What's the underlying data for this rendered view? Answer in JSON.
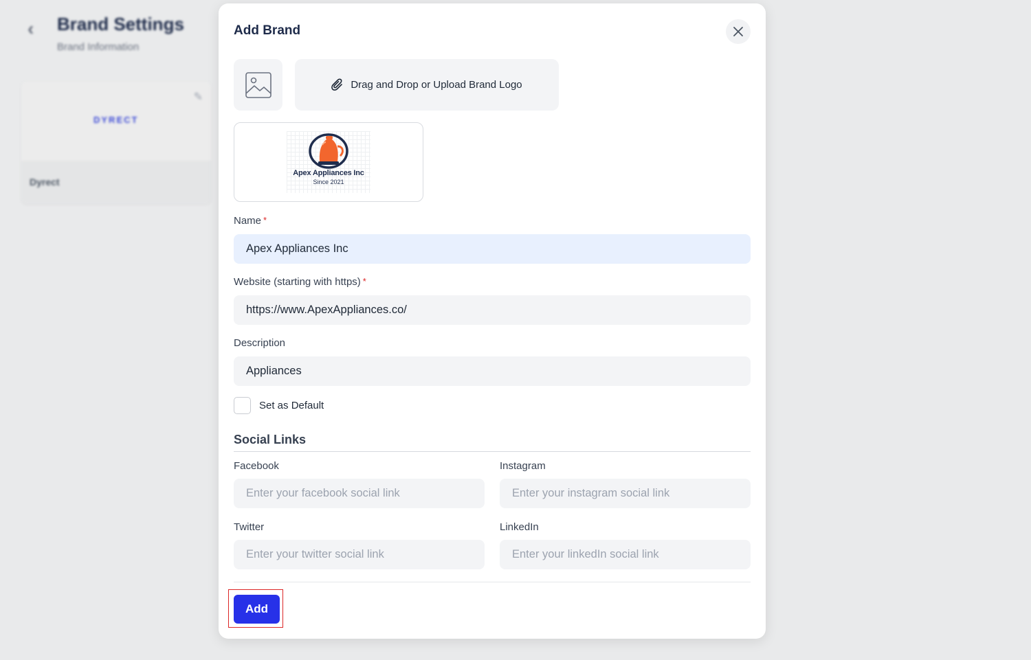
{
  "background": {
    "back_icon": "chevron-left-icon",
    "title": "Brand Settings",
    "subtitle": "Brand Information",
    "card": {
      "logo_text": "DYRECT",
      "name": "Dyrect",
      "edit_icon": "pencil-icon"
    }
  },
  "modal": {
    "title": "Add Brand",
    "close_icon": "close-icon",
    "image_placeholder_icon": "image-icon",
    "upload": {
      "icon": "paperclip-icon",
      "label": "Drag and Drop or Upload Brand Logo"
    },
    "logo_preview": {
      "brand_text": "Apex Appliances Inc",
      "since_text": "Since 2021"
    },
    "fields": {
      "name": {
        "label": "Name",
        "required_mark": "*",
        "value": "Apex Appliances Inc"
      },
      "website": {
        "label": "Website (starting with https)",
        "required_mark": "*",
        "value": "https://www.ApexAppliances.co/"
      },
      "description": {
        "label": "Description",
        "value": "Appliances"
      }
    },
    "default_checkbox": {
      "label": "Set as Default",
      "checked": false
    },
    "social": {
      "title": "Social Links",
      "facebook": {
        "label": "Facebook",
        "placeholder": "Enter your facebook social link"
      },
      "instagram": {
        "label": "Instagram",
        "placeholder": "Enter your instagram social link"
      },
      "twitter": {
        "label": "Twitter",
        "placeholder": "Enter your twitter social link"
      },
      "linkedin": {
        "label": "LinkedIn",
        "placeholder": "Enter your linkedIn social link"
      }
    },
    "add_button": "Add"
  },
  "colors": {
    "primary": "#2731e8",
    "required": "#dc2626",
    "input_bg": "#f3f4f6",
    "active_input_bg": "#e8f0fe",
    "highlight_frame": "#dc2626"
  }
}
